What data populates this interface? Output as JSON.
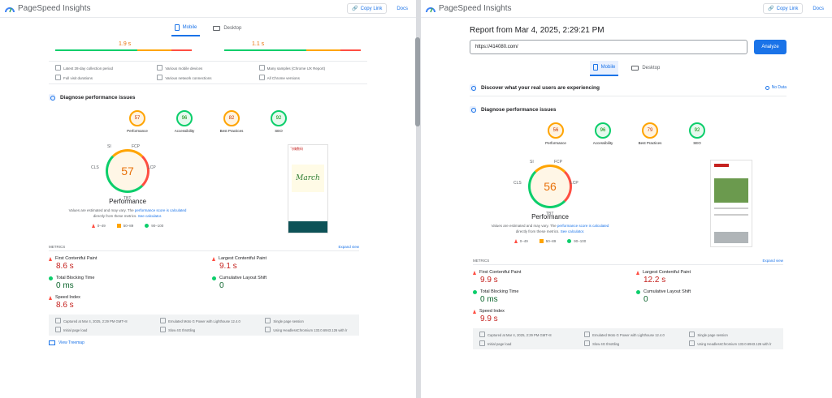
{
  "app": {
    "name": "PageSpeed Insights",
    "copy_link": "Copy Link",
    "docs": "Docs"
  },
  "tabs": {
    "mobile": "Mobile",
    "desktop": "Desktop"
  },
  "left": {
    "field_bars": [
      {
        "value": "1.9 s"
      },
      {
        "value": "1.1 s"
      }
    ],
    "info": [
      "Latest 28-day collection period",
      "Various mobile devices",
      "Many samples (Chrome UX Report)",
      "Full visit durations",
      "Various network connections",
      "All Chrome versions"
    ],
    "diagnose_title": "Diagnose performance issues",
    "scores": [
      {
        "label": "Performance",
        "value": "57",
        "status": "orange"
      },
      {
        "label": "Accessibility",
        "value": "96",
        "status": "green"
      },
      {
        "label": "Best Practices",
        "value": "82",
        "status": "orange"
      },
      {
        "label": "SEO",
        "value": "92",
        "status": "green"
      }
    ],
    "big_score": "57",
    "gauge_labels": {
      "si": "SI",
      "fcp": "FCP",
      "cls": "CLS",
      "lcp": "LCP",
      "tbt": "TBT"
    },
    "perf_title": "Performance",
    "note_1": "Values are estimated and may vary. The",
    "note_link": "performance score is calculated",
    "note_2": "directly from these metrics.",
    "note_calc": "See calculator.",
    "legend": [
      "0–49",
      "50–89",
      "90–100"
    ],
    "metrics_label": "METRICS",
    "expand": "Expand view",
    "metrics": [
      {
        "name": "First Contentful Paint",
        "value": "8.6 s",
        "status": "red"
      },
      {
        "name": "Largest Contentful Paint",
        "value": "9.1 s",
        "status": "red"
      },
      {
        "name": "Total Blocking Time",
        "value": "0 ms",
        "status": "green"
      },
      {
        "name": "Cumulative Layout Shift",
        "value": "0",
        "status": "green"
      },
      {
        "name": "Speed Index",
        "value": "8.6 s",
        "status": "red"
      }
    ],
    "footer": [
      "Captured at Mar 4, 2025, 2:29 PM GMT+8",
      "Emulated Moto G Power with Lighthouse 12.4.0",
      "Single page session",
      "Initial page load",
      "Slow 4G throttling",
      "Using HeadlessChromium 133.0.6943.126 with lr"
    ],
    "treemap": "View Treemap",
    "phone_text": [
      "飞嗨数码",
      "March"
    ]
  },
  "right": {
    "report_title": "Report from Mar 4, 2025, 2:29:21 PM",
    "url": "https://414080.com/",
    "analyze": "Analyze",
    "discover": "Discover what your real users are experiencing",
    "no_data": "No Data",
    "diagnose_title": "Diagnose performance issues",
    "scores": [
      {
        "label": "Performance",
        "value": "56",
        "status": "orange"
      },
      {
        "label": "Accessibility",
        "value": "96",
        "status": "green"
      },
      {
        "label": "Best Practices",
        "value": "79",
        "status": "orange"
      },
      {
        "label": "SEO",
        "value": "92",
        "status": "green"
      }
    ],
    "big_score": "56",
    "perf_title": "Performance",
    "metrics_label": "METRICS",
    "expand": "Expand view",
    "metrics": [
      {
        "name": "First Contentful Paint",
        "value": "9.9 s",
        "status": "red"
      },
      {
        "name": "Largest Contentful Paint",
        "value": "12.2 s",
        "status": "red"
      },
      {
        "name": "Total Blocking Time",
        "value": "0 ms",
        "status": "green"
      },
      {
        "name": "Cumulative Layout Shift",
        "value": "0",
        "status": "green"
      },
      {
        "name": "Speed Index",
        "value": "9.9 s",
        "status": "red"
      }
    ],
    "footer": [
      "Captured at Mar 4, 2025, 2:29 PM GMT+8",
      "Emulated Moto G Power with Lighthouse 12.4.0",
      "Single page session",
      "Initial page load",
      "Slow 4G throttling",
      "Using HeadlessChromium 133.0.6943.126 with lr"
    ]
  }
}
